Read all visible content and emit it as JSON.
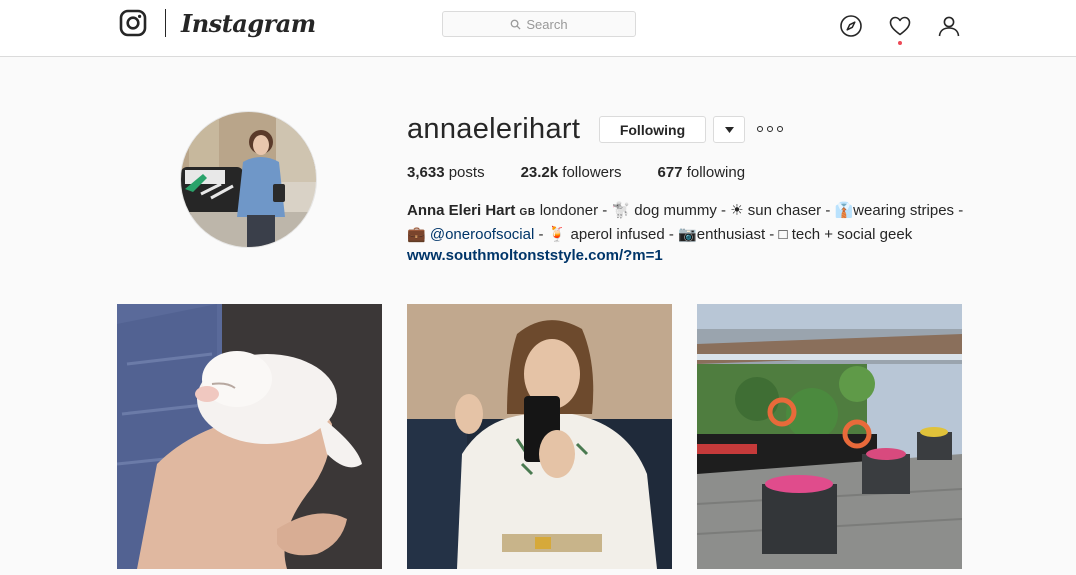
{
  "nav": {
    "wordmark": "Instagram",
    "search_placeholder": "Search",
    "icons": [
      "instagram-glyph-icon",
      "compass-icon",
      "heart-icon",
      "user-icon"
    ],
    "notification_dot_color": "#ed4956"
  },
  "profile": {
    "username": "annaelerihart",
    "follow_button_label": "Following",
    "dropdown_icon": "caret-down-icon",
    "more_icon": "more-options-icon",
    "stats": {
      "posts_count": "3,633",
      "posts_label": "posts",
      "followers_count": "23.2k",
      "followers_label": "followers",
      "following_count": "677",
      "following_label": "following"
    },
    "bio": {
      "full_name": "Anna Eleri Hart",
      "flag": "GB",
      "seg1": " londoner - ",
      "dog_emoji": "🐩",
      "seg2": " dog mummy - ",
      "sun_emoji": "☀",
      "seg3": " sun chaser - ",
      "stripes_emoji": "👔",
      "seg4": "wearing stripes -",
      "briefcase_emoji": "💼",
      "mention": "@oneroofsocial",
      "seg5": " - ",
      "drink_emoji": "🍹",
      "seg6": " aperol infused - ",
      "third_emoji": "📷",
      "seg7": "enthusiast - ",
      "fourth_emoji": "□",
      "seg8": " tech + social geek",
      "website": "www.southmoltonststyle.com/?m=1"
    }
  },
  "posts": [
    {
      "subject": "puppy-in-hands-photo"
    },
    {
      "subject": "mirror-selfie-photo"
    },
    {
      "subject": "canal-boat-flowers-photo"
    }
  ]
}
